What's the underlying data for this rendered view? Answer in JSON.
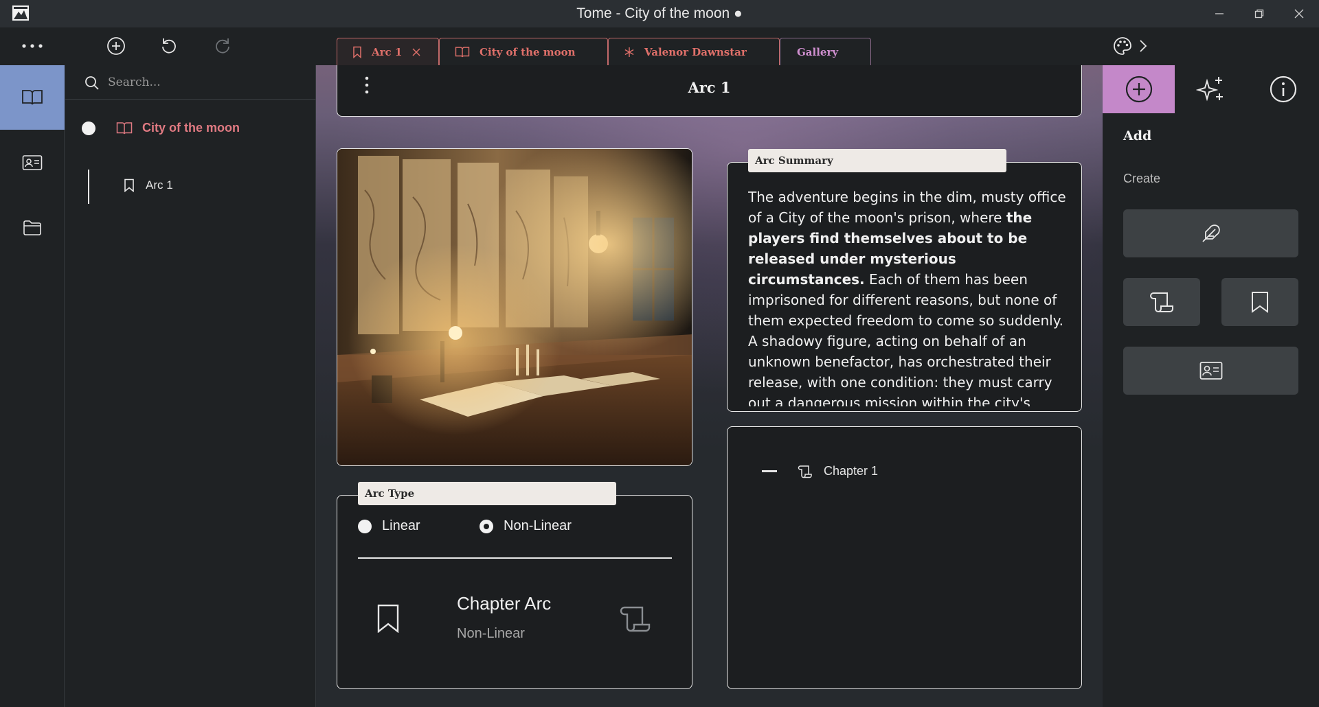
{
  "window": {
    "title": "Tome - City of the moon ●"
  },
  "tabs": [
    {
      "label": "Arc 1",
      "icon": "bookmark-icon",
      "closable": true,
      "active": true
    },
    {
      "label": "City of the moon",
      "icon": "book-icon"
    },
    {
      "label": "Valenor Dawnstar",
      "icon": "asterisk-icon"
    },
    {
      "label": "Gallery"
    }
  ],
  "search": {
    "placeholder": "Search..."
  },
  "tree": {
    "root": {
      "label": "City of the moon",
      "icon": "book-icon"
    },
    "children": [
      {
        "label": "Arc 1",
        "icon": "bookmark-icon"
      }
    ]
  },
  "page": {
    "title": "Arc 1"
  },
  "summary": {
    "label": "Arc Summary",
    "text_before": "The adventure begins in the dim, musty office of a City of the moon's prison, where ",
    "text_bold": "the players find themselves about to be released under mysterious circumstances.",
    "text_after": " Each of them has been imprisoned for different reasons, but none of them expected freedom to come so suddenly. A shadowy figure, acting on behalf of an unknown benefactor, has orchestrated their release, with one condition: they must carry out a dangerous mission within the city's"
  },
  "arc_type": {
    "label": "Arc Type",
    "options": [
      {
        "label": "Linear",
        "selected": false
      },
      {
        "label": "Non-Linear",
        "selected": true
      }
    ],
    "linked": {
      "title": "Chapter Arc",
      "subtitle": "Non-Linear"
    }
  },
  "chapters": [
    {
      "label": "Chapter 1",
      "icon": "scroll-icon"
    }
  ],
  "right_panel": {
    "heading": "Add",
    "subheading": "Create"
  },
  "colors": {
    "accent_tab": "#e0706a",
    "accent_gallery": "#cf8fcf",
    "rail_active": "#7c95c9",
    "rp_tab_active": "#c488c9",
    "tree_root": "#e07a82"
  }
}
